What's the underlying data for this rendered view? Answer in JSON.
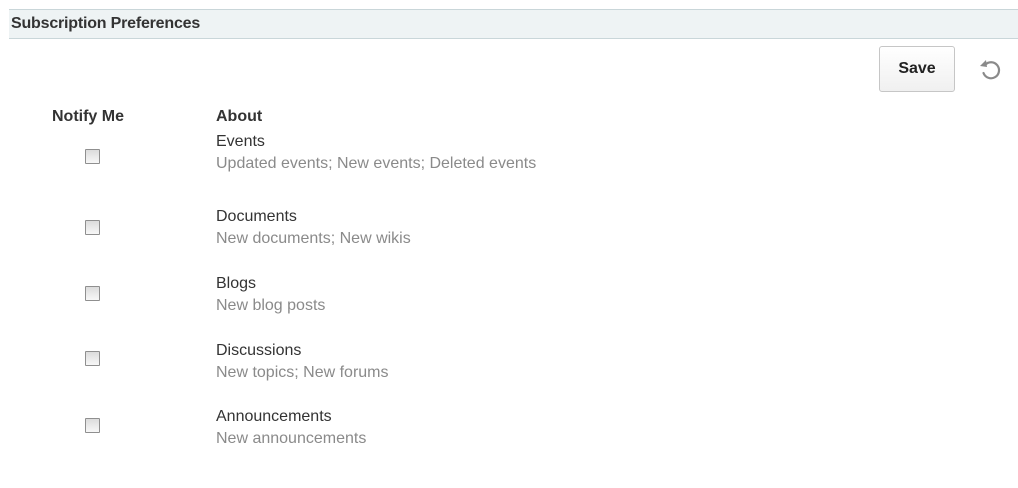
{
  "header": {
    "title": "Subscription Preferences"
  },
  "toolbar": {
    "save_label": "Save",
    "reset_icon": "reset-icon"
  },
  "columns": {
    "notify": "Notify Me",
    "about": "About"
  },
  "preferences": [
    {
      "title": "Events",
      "description": "Updated events; New events; Deleted events",
      "checked": false
    },
    {
      "title": "Documents",
      "description": "New documents; New wikis",
      "checked": false
    },
    {
      "title": "Blogs",
      "description": "New blog posts",
      "checked": false
    },
    {
      "title": "Discussions",
      "description": "New topics; New forums",
      "checked": false
    },
    {
      "title": "Announcements",
      "description": "New announcements",
      "checked": false
    }
  ],
  "colors": {
    "header_bg": "#eef3f4",
    "text": "#333333",
    "secondary_text": "#8a8a8a"
  }
}
